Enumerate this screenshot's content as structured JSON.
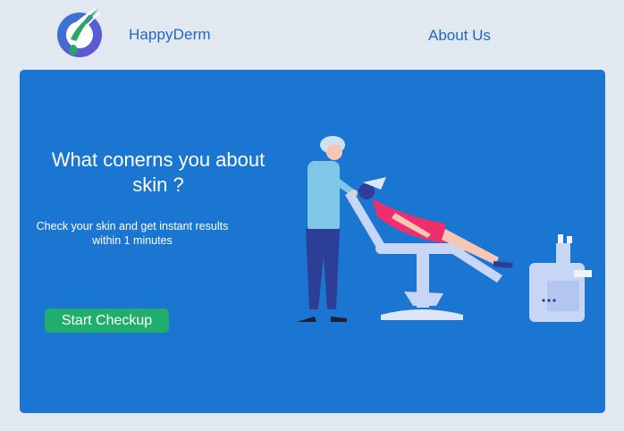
{
  "header": {
    "brand_name": "HappyDerm",
    "nav_about": "About Us"
  },
  "hero": {
    "headline": "What conerns you about skin ?",
    "subtext": "Check your skin and get instant results within 1 minutes",
    "cta_label": "Start Checkup"
  },
  "colors": {
    "page_background": "#e2e8ef",
    "hero_background": "#1b76d2",
    "brand_text": "#1f68c2",
    "cta_button": "#21ae6c"
  },
  "icons": {
    "logo": "hair-follicle-logo-icon",
    "illustration": "dermatologist-patient-illustration"
  }
}
